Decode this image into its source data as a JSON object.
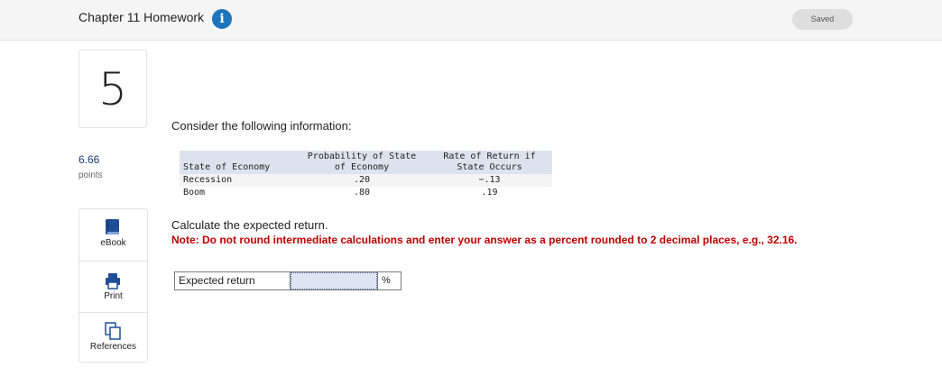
{
  "header": {
    "title": "Chapter 11 Homework",
    "info_icon": "i",
    "saved_label": "Saved"
  },
  "question": {
    "number": "5",
    "points_value": "6.66",
    "points_label": "points"
  },
  "tools": [
    {
      "label": "eBook",
      "icon": "book-icon"
    },
    {
      "label": "Print",
      "icon": "printer-icon"
    },
    {
      "label": "References",
      "icon": "copy-icon"
    }
  ],
  "content": {
    "intro": "Consider the following information:",
    "table": {
      "headers": [
        "State of Economy",
        "Probability of State of Economy",
        "Rate of Return if State Occurs"
      ],
      "header_lines": {
        "col2_line1": "Probability of State",
        "col2_line2": "of Economy",
        "col3_line1": "Rate of Return if",
        "col3_line2": "State Occurs"
      },
      "rows": [
        {
          "state": "Recession",
          "probability": ".20",
          "return": "−.13"
        },
        {
          "state": "Boom",
          "probability": ".80",
          "return": ".19"
        }
      ]
    },
    "instruction": "Calculate the expected return.",
    "note": "Note: Do not round intermediate calculations and enter your answer as a percent rounded to 2 decimal places, e.g., 32.16.",
    "answer": {
      "label": "Expected return",
      "value": "",
      "unit": "%"
    }
  },
  "colors": {
    "accent": "#1c75bc",
    "note_red": "#c00000",
    "table_header_bg": "#dde3ee",
    "input_bg": "#dce6f3"
  }
}
